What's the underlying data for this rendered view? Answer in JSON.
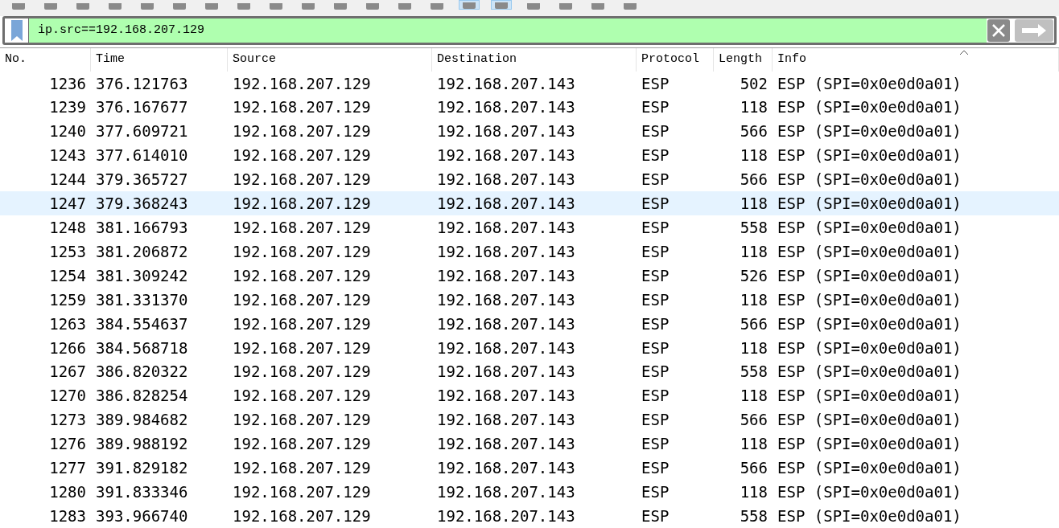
{
  "toolbar": {
    "buttons": [
      {
        "selected": false
      },
      {
        "selected": false
      },
      {
        "selected": false
      },
      {
        "selected": false
      },
      {
        "selected": false
      },
      {
        "selected": false
      },
      {
        "selected": false
      },
      {
        "selected": false
      },
      {
        "selected": false
      },
      {
        "selected": false
      },
      {
        "selected": false
      },
      {
        "selected": false
      },
      {
        "selected": false
      },
      {
        "selected": false
      },
      {
        "selected": true
      },
      {
        "selected": true
      },
      {
        "selected": false
      },
      {
        "selected": false
      },
      {
        "selected": false
      },
      {
        "selected": false
      }
    ]
  },
  "filter": {
    "value": "ip.src==192.168.207.129"
  },
  "table": {
    "columns": [
      "No.",
      "Time",
      "Source",
      "Destination",
      "Protocol",
      "Length",
      "Info"
    ],
    "rows": [
      {
        "selected": false,
        "cells": [
          "1236",
          "376.121763",
          "192.168.207.129",
          "192.168.207.143",
          "ESP",
          "502",
          "ESP (SPI=0x0e0d0a01)"
        ]
      },
      {
        "selected": false,
        "cells": [
          "1239",
          "376.167677",
          "192.168.207.129",
          "192.168.207.143",
          "ESP",
          "118",
          "ESP (SPI=0x0e0d0a01)"
        ]
      },
      {
        "selected": false,
        "cells": [
          "1240",
          "377.609721",
          "192.168.207.129",
          "192.168.207.143",
          "ESP",
          "566",
          "ESP (SPI=0x0e0d0a01)"
        ]
      },
      {
        "selected": false,
        "cells": [
          "1243",
          "377.614010",
          "192.168.207.129",
          "192.168.207.143",
          "ESP",
          "118",
          "ESP (SPI=0x0e0d0a01)"
        ]
      },
      {
        "selected": false,
        "cells": [
          "1244",
          "379.365727",
          "192.168.207.129",
          "192.168.207.143",
          "ESP",
          "566",
          "ESP (SPI=0x0e0d0a01)"
        ]
      },
      {
        "selected": true,
        "cells": [
          "1247",
          "379.368243",
          "192.168.207.129",
          "192.168.207.143",
          "ESP",
          "118",
          "ESP (SPI=0x0e0d0a01)"
        ]
      },
      {
        "selected": false,
        "cells": [
          "1248",
          "381.166793",
          "192.168.207.129",
          "192.168.207.143",
          "ESP",
          "558",
          "ESP (SPI=0x0e0d0a01)"
        ]
      },
      {
        "selected": false,
        "cells": [
          "1253",
          "381.206872",
          "192.168.207.129",
          "192.168.207.143",
          "ESP",
          "118",
          "ESP (SPI=0x0e0d0a01)"
        ]
      },
      {
        "selected": false,
        "cells": [
          "1254",
          "381.309242",
          "192.168.207.129",
          "192.168.207.143",
          "ESP",
          "526",
          "ESP (SPI=0x0e0d0a01)"
        ]
      },
      {
        "selected": false,
        "cells": [
          "1259",
          "381.331370",
          "192.168.207.129",
          "192.168.207.143",
          "ESP",
          "118",
          "ESP (SPI=0x0e0d0a01)"
        ]
      },
      {
        "selected": false,
        "cells": [
          "1263",
          "384.554637",
          "192.168.207.129",
          "192.168.207.143",
          "ESP",
          "566",
          "ESP (SPI=0x0e0d0a01)"
        ]
      },
      {
        "selected": false,
        "cells": [
          "1266",
          "384.568718",
          "192.168.207.129",
          "192.168.207.143",
          "ESP",
          "118",
          "ESP (SPI=0x0e0d0a01)"
        ]
      },
      {
        "selected": false,
        "cells": [
          "1267",
          "386.820322",
          "192.168.207.129",
          "192.168.207.143",
          "ESP",
          "558",
          "ESP (SPI=0x0e0d0a01)"
        ]
      },
      {
        "selected": false,
        "cells": [
          "1270",
          "386.828254",
          "192.168.207.129",
          "192.168.207.143",
          "ESP",
          "118",
          "ESP (SPI=0x0e0d0a01)"
        ]
      },
      {
        "selected": false,
        "cells": [
          "1273",
          "389.984682",
          "192.168.207.129",
          "192.168.207.143",
          "ESP",
          "566",
          "ESP (SPI=0x0e0d0a01)"
        ]
      },
      {
        "selected": false,
        "cells": [
          "1276",
          "389.988192",
          "192.168.207.129",
          "192.168.207.143",
          "ESP",
          "118",
          "ESP (SPI=0x0e0d0a01)"
        ]
      },
      {
        "selected": false,
        "cells": [
          "1277",
          "391.829182",
          "192.168.207.129",
          "192.168.207.143",
          "ESP",
          "566",
          "ESP (SPI=0x0e0d0a01)"
        ]
      },
      {
        "selected": false,
        "cells": [
          "1280",
          "391.833346",
          "192.168.207.129",
          "192.168.207.143",
          "ESP",
          "118",
          "ESP (SPI=0x0e0d0a01)"
        ]
      },
      {
        "selected": false,
        "cells": [
          "1283",
          "393.966740",
          "192.168.207.129",
          "192.168.207.143",
          "ESP",
          "558",
          "ESP (SPI=0x0e0d0a01)"
        ]
      }
    ]
  }
}
